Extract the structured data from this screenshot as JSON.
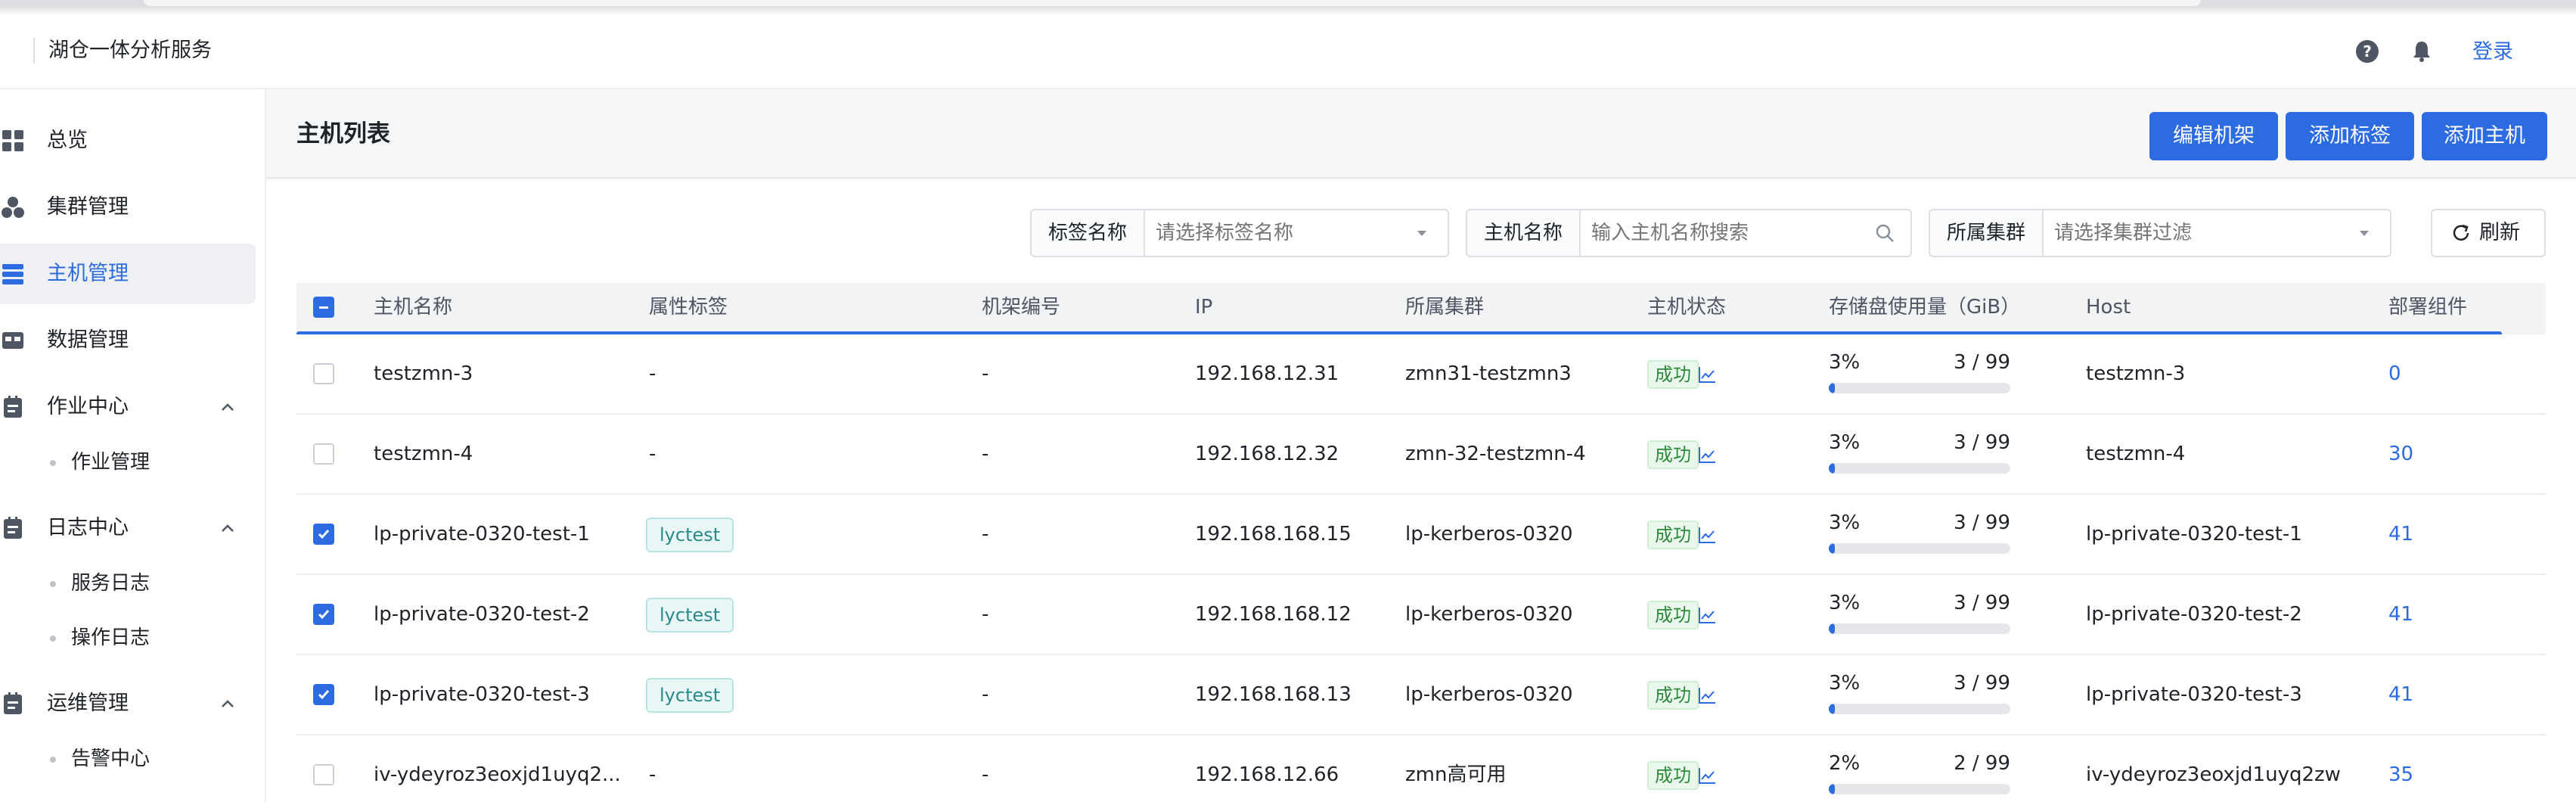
{
  "header": {
    "brand": "湖仓一体分析服务",
    "login_label": "登录"
  },
  "sidebar": {
    "items": [
      {
        "label": "总览",
        "icon": "dashboard-icon",
        "active": false
      },
      {
        "label": "集群管理",
        "icon": "cluster-icon",
        "active": false
      },
      {
        "label": "主机管理",
        "icon": "server-icon",
        "active": true
      },
      {
        "label": "数据管理",
        "icon": "database-icon",
        "active": false
      },
      {
        "label": "作业中心",
        "icon": "job-icon",
        "active": false,
        "expanded": true,
        "children": [
          "作业管理"
        ]
      },
      {
        "label": "日志中心",
        "icon": "log-icon",
        "active": false,
        "expanded": true,
        "children": [
          "服务日志",
          "操作日志"
        ]
      },
      {
        "label": "运维管理",
        "icon": "ops-icon",
        "active": false,
        "expanded": true,
        "children": [
          "告警中心"
        ]
      }
    ]
  },
  "page": {
    "title": "主机列表",
    "buttons": {
      "edit_rack": "编辑机架",
      "add_tag": "添加标签",
      "add_host": "添加主机"
    },
    "filters": {
      "tag_label": "标签名称",
      "tag_placeholder": "请选择标签名称",
      "host_label": "主机名称",
      "host_placeholder": "输入主机名称搜索",
      "cluster_label": "所属集群",
      "cluster_placeholder": "请选择集群过滤",
      "refresh_label": "刷新"
    }
  },
  "table": {
    "columns": [
      "主机名称",
      "属性标签",
      "机架编号",
      "IP",
      "所属集群",
      "主机状态",
      "存储盘使用量（GiB）",
      "Host",
      "部署组件"
    ],
    "rows": [
      {
        "checked": false,
        "name": "testzmn-3",
        "tag": "-",
        "rack": "-",
        "ip": "192.168.12.31",
        "cluster": "zmn31-testzmn3",
        "status": "成功",
        "usage_pct": "3%",
        "usage_ratio": "3 / 99",
        "usage_fraction": 0.03,
        "host": "testzmn-3",
        "components": "0"
      },
      {
        "checked": false,
        "name": "testzmn-4",
        "tag": "-",
        "rack": "-",
        "ip": "192.168.12.32",
        "cluster": "zmn-32-testzmn-4",
        "status": "成功",
        "usage_pct": "3%",
        "usage_ratio": "3 / 99",
        "usage_fraction": 0.03,
        "host": "testzmn-4",
        "components": "30"
      },
      {
        "checked": true,
        "name": "lp-private-0320-test-1",
        "tag": "lyctest",
        "rack": "-",
        "ip": "192.168.168.15",
        "cluster": "lp-kerberos-0320",
        "status": "成功",
        "usage_pct": "3%",
        "usage_ratio": "3 / 99",
        "usage_fraction": 0.03,
        "host": "lp-private-0320-test-1",
        "components": "41"
      },
      {
        "checked": true,
        "name": "lp-private-0320-test-2",
        "tag": "lyctest",
        "rack": "-",
        "ip": "192.168.168.12",
        "cluster": "lp-kerberos-0320",
        "status": "成功",
        "usage_pct": "3%",
        "usage_ratio": "3 / 99",
        "usage_fraction": 0.03,
        "host": "lp-private-0320-test-2",
        "components": "41"
      },
      {
        "checked": true,
        "name": "lp-private-0320-test-3",
        "tag": "lyctest",
        "rack": "-",
        "ip": "192.168.168.13",
        "cluster": "lp-kerberos-0320",
        "status": "成功",
        "usage_pct": "3%",
        "usage_ratio": "3 / 99",
        "usage_fraction": 0.03,
        "host": "lp-private-0320-test-3",
        "components": "41"
      },
      {
        "checked": false,
        "name": "iv-ydeyroz3eoxjd1uyq2...",
        "tag": "-",
        "rack": "-",
        "ip": "192.168.12.66",
        "cluster": "zmn高可用",
        "status": "成功",
        "usage_pct": "2%",
        "usage_ratio": "2 / 99",
        "usage_fraction": 0.02,
        "host": "iv-ydeyroz3eoxjd1uyq2zw",
        "components": "35"
      }
    ]
  },
  "colors": {
    "accent": "#2c6be0",
    "success_text": "#2d8a3c",
    "tag_text": "#2a8a8a"
  }
}
